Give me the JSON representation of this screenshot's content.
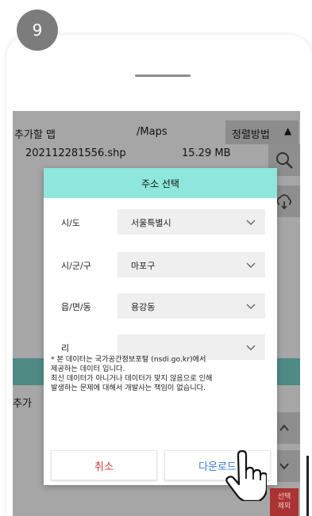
{
  "step": {
    "number": "9"
  },
  "app": {
    "header": {
      "target_label": "추가할 맵",
      "path": "/Maps",
      "sort_label": "정렬방법",
      "sort_arrow": "▲"
    },
    "file": {
      "name": "202112281556.shp",
      "size": "15.29 MB"
    },
    "add_label": "추가",
    "select_button": "선택\n제외"
  },
  "dialog": {
    "title": "주소 선택",
    "fields": [
      {
        "label": "시/도",
        "value": "서울특별시"
      },
      {
        "label": "시/군/구",
        "value": "마포구"
      },
      {
        "label": "읍/면/동",
        "value": "용강동"
      },
      {
        "label": "리",
        "value": ""
      }
    ],
    "notice": [
      "* 본 데이터는 국가공간정보포털 (nsdi.go.kr)에서",
      "제공하는 데이터 입니다.",
      "최신 데이터가 아니거나 데이터가 맞지 않음으로 인해",
      "발생하는 문제에 대해서 개발사는 책임이 없습니다."
    ],
    "cancel_label": "취소",
    "download_label": "다운로드"
  },
  "colors": {
    "dialog_header": "#8ee6dd",
    "cancel_text": "#d03838",
    "download_text": "#3a7bd5"
  },
  "icons": [
    "search-icon",
    "cloud-download-icon",
    "chevron-up-icon",
    "chevron-down-icon",
    "hand-pointer-icon"
  ]
}
